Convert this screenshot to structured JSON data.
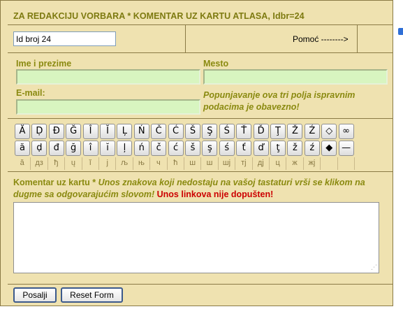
{
  "header": {
    "title": "ZA REDAKCIJU VORBARA * KOMENTAR UZ KARTU ATLASA, Idbr=24"
  },
  "id_field": {
    "value": "Id broj 24"
  },
  "help_link": {
    "label": "Pomoć -------->"
  },
  "form": {
    "name_label": "Ime i prezime",
    "place_label": "Mesto",
    "email_label": "E-mail:",
    "notice": "Popunjavanje ova tri polja ispravnim podacima je obavezno!"
  },
  "keyboard": {
    "upper": [
      "Ă",
      "Ḍ",
      "Đ",
      "Ğ",
      "Î",
      "Ĭ",
      "Ļ",
      "Ń",
      "Č",
      "Ć",
      "Š",
      "Ş",
      "Ś",
      "Ť",
      "Ď",
      "Ţ",
      "Ž",
      "Ź",
      "◇",
      "∞"
    ],
    "lower": [
      "ă",
      "ḍ",
      "đ",
      "ğ",
      "î",
      "ĭ",
      "ļ",
      "ń",
      "č",
      "ć",
      "š",
      "ş",
      "ś",
      "ť",
      "ď",
      "ţ",
      "ž",
      "ź",
      "◆",
      "—"
    ],
    "cyrillic": [
      "ă",
      "дз",
      "ђ",
      "ų",
      "ĭ",
      "j",
      "љ",
      "њ",
      "ч",
      "ћ",
      "ш",
      "ш",
      "шj",
      "тj",
      "дj",
      "ц",
      "ж",
      "жj",
      "",
      ""
    ]
  },
  "comment": {
    "label": "Komentar uz kartu *",
    "hint": "Unos znakova koji nedostaju na vašoj tastaturi vrši se klikom na dugme sa odgovarajućim slovom!",
    "warning": "Unos linkova nije dopušten!",
    "value": ""
  },
  "buttons": {
    "send": "Posalji",
    "reset": "Reset Form"
  },
  "colors": {
    "panel": "#efe2b0",
    "label": "#8a8a10",
    "input": "#d8f5c0",
    "warning": "#cc0000"
  }
}
